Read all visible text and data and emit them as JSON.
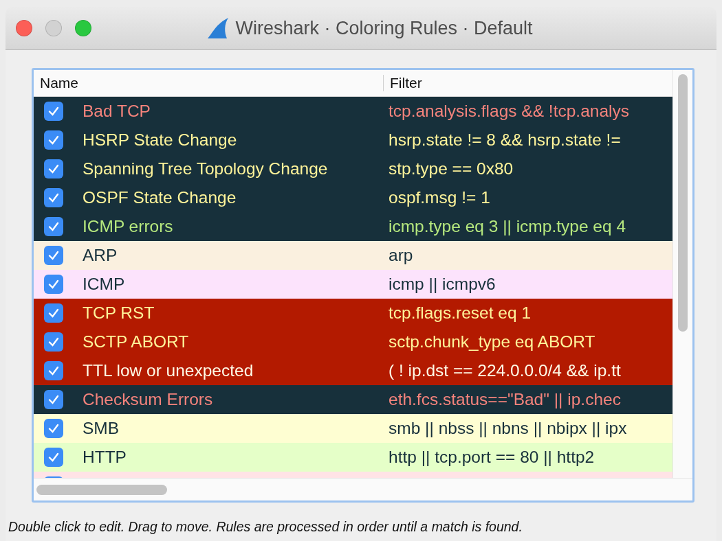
{
  "window": {
    "title": "Wireshark · Coloring Rules · Default"
  },
  "table": {
    "columns": [
      "Name",
      "Filter"
    ],
    "rows": [
      {
        "checked": true,
        "name": "Bad TCP",
        "filter": "tcp.analysis.flags && !tcp.analys",
        "color": "#17303b",
        "text": {
          "color": "#f5837c"
        }
      },
      {
        "checked": true,
        "name": "HSRP State Change",
        "filter": "hsrp.state != 8 && hsrp.state !=",
        "color": "#17303b",
        "text": {
          "color": "#fff49a"
        }
      },
      {
        "checked": true,
        "name": "Spanning Tree Topology  Change",
        "filter": "stp.type == 0x80",
        "color": "#17303b",
        "text": {
          "color": "#fff49a"
        }
      },
      {
        "checked": true,
        "name": "OSPF State Change",
        "filter": "ospf.msg != 1",
        "color": "#17303b",
        "text": {
          "color": "#fff49a"
        }
      },
      {
        "checked": true,
        "name": "ICMP errors",
        "filter": "icmp.type eq 3 || icmp.type eq 4",
        "color": "#17303b",
        "text": {
          "color": "#b6e87e"
        }
      },
      {
        "checked": true,
        "name": "ARP",
        "filter": "arp",
        "color": "#faf0df",
        "text": {
          "color": "#17303b"
        }
      },
      {
        "checked": true,
        "name": "ICMP",
        "filter": "icmp || icmpv6",
        "color": "#fce3fc",
        "text": {
          "color": "#17303b"
        }
      },
      {
        "checked": true,
        "name": "TCP RST",
        "filter": "tcp.flags.reset eq 1",
        "color": "#b31a00",
        "text": {
          "color": "#fff49a"
        }
      },
      {
        "checked": true,
        "name": "SCTP ABORT",
        "filter": "sctp.chunk_type eq ABORT",
        "color": "#b31a00",
        "text": {
          "color": "#fff49a"
        }
      },
      {
        "checked": true,
        "name": "TTL low or unexpected",
        "filter": "( ! ip.dst == 224.0.0.0/4 && ip.tt",
        "color": "#b31a00",
        "text": {
          "color": "#fffbe6"
        }
      },
      {
        "checked": true,
        "name": "Checksum Errors",
        "filter": "eth.fcs.status==\"Bad\" || ip.chec",
        "color": "#17303b",
        "text": {
          "color": "#f5837c"
        }
      },
      {
        "checked": true,
        "name": "SMB",
        "filter": "smb || nbss || nbns || nbipx || ipx",
        "color": "#fefed2",
        "text": {
          "color": "#17303b"
        }
      },
      {
        "checked": true,
        "name": "HTTP",
        "filter": "http || tcp.port == 80 || http2",
        "color": "#e5ffc8",
        "text": {
          "color": "#17303b"
        }
      },
      {
        "checked": true,
        "color": "#ffe3e6"
      }
    ]
  },
  "hint": "Double click to edit. Drag to move. Rules are processed in order until a match is found."
}
